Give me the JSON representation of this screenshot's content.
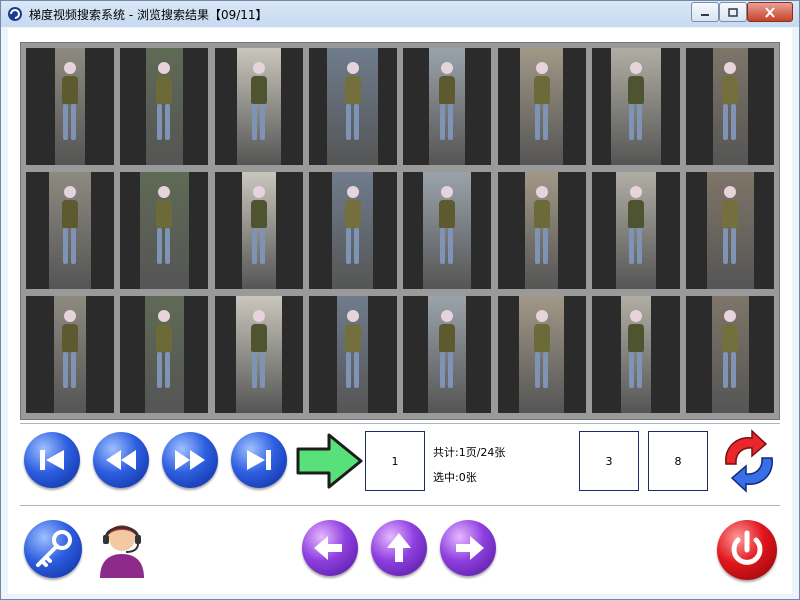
{
  "window": {
    "title": "梯度视频搜索系统 - 浏览搜索结果【09/11】",
    "buttons": {
      "minimize": "▭",
      "maximize": "▢",
      "close": "✕"
    }
  },
  "results": {
    "rows": 3,
    "columns": 8,
    "thumbnails": [
      {
        "id": 1
      },
      {
        "id": 2
      },
      {
        "id": 3
      },
      {
        "id": 4
      },
      {
        "id": 5
      },
      {
        "id": 6
      },
      {
        "id": 7
      },
      {
        "id": 8
      },
      {
        "id": 9
      },
      {
        "id": 10
      },
      {
        "id": 11
      },
      {
        "id": 12
      },
      {
        "id": 13
      },
      {
        "id": 14
      },
      {
        "id": 15
      },
      {
        "id": 16
      },
      {
        "id": 17
      },
      {
        "id": 18
      },
      {
        "id": 19
      },
      {
        "id": 20
      },
      {
        "id": 21
      },
      {
        "id": 22
      },
      {
        "id": 23
      },
      {
        "id": 24
      }
    ]
  },
  "pagination": {
    "page_input": "1",
    "total_label": "共计:1页/24张",
    "selected_label": "选中:0张",
    "rows_value": "3",
    "cols_value": "8"
  },
  "icons": {
    "first": "skip-first-icon",
    "prev": "rewind-icon",
    "next": "fast-forward-icon",
    "last": "skip-last-icon",
    "go": "green-arrow-right-icon",
    "refresh": "refresh-arrows-icon",
    "key": "key-icon",
    "user": "user-support-icon",
    "back": "arrow-left-icon",
    "up": "arrow-up-icon",
    "forward": "arrow-right-icon",
    "power": "power-icon"
  },
  "colors": {
    "title_bar": "#c5d9f0",
    "nav_blue": "#2e5fe0",
    "nav_purple": "#8f3fe0",
    "go_green": "#58e07a",
    "power_red": "#d8141a",
    "gallery_bg": "#9a9a9a",
    "thumb_bg": "#2b2b2b"
  }
}
